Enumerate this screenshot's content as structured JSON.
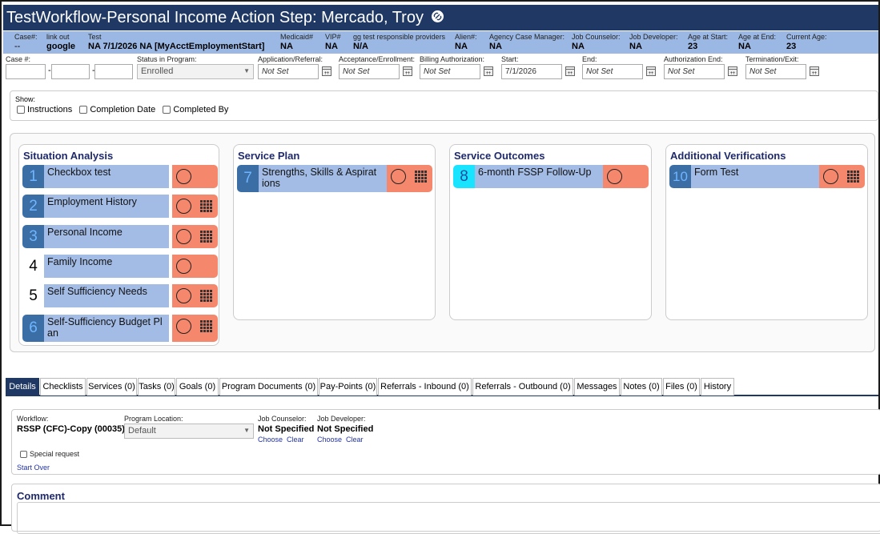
{
  "title": "TestWorkflow-Personal Income Action Step: Mercado, Troy",
  "info": [
    {
      "label": "Case#:",
      "value": "--"
    },
    {
      "label": "link out",
      "value": "google"
    },
    {
      "label": "Test",
      "value": "NA 7/1/2026 NA [MyAcctEmploymentStart]"
    },
    {
      "label": "Medicaid#",
      "value": "NA"
    },
    {
      "label": "VIP#",
      "value": "NA"
    },
    {
      "label": "gg test responsible providers",
      "value": "N/A"
    },
    {
      "label": "Alien#:",
      "value": "NA"
    },
    {
      "label": "Agency Case Manager:",
      "value": "NA"
    },
    {
      "label": "Job Counselor:",
      "value": "NA"
    },
    {
      "label": "Job Developer:",
      "value": "NA"
    },
    {
      "label": "Age at Start:",
      "value": "23"
    },
    {
      "label": "Age at End:",
      "value": "NA"
    },
    {
      "label": "Current Age:",
      "value": "23"
    }
  ],
  "fields": {
    "case_label": "Case #:",
    "status_label": "Status in Program:",
    "status_value": "Enrolled",
    "dates": [
      {
        "label": "Application/Referral:",
        "value": "Not Set"
      },
      {
        "label": "Acceptance/Enrollment:",
        "value": "Not Set"
      },
      {
        "label": "Billing Authorization:",
        "value": "Not Set"
      },
      {
        "label": "Start:",
        "value": "7/1/2026"
      },
      {
        "label": "End:",
        "value": "Not Set"
      },
      {
        "label": "Authorization End:",
        "value": "Not Set"
      },
      {
        "label": "Termination/Exit:",
        "value": "Not Set"
      }
    ]
  },
  "show": {
    "label": "Show:",
    "options": [
      "Instructions",
      "Completion Date",
      "Completed By"
    ]
  },
  "columns": [
    {
      "title": "Situation Analysis",
      "steps": [
        {
          "num": "1",
          "name": "Checkbox test"
        },
        {
          "num": "2",
          "name": "Employment History"
        },
        {
          "num": "3",
          "name": "Personal Income"
        },
        {
          "num": "4",
          "name": "Family Income"
        },
        {
          "num": "5",
          "name": "Self Sufficiency Needs"
        },
        {
          "num": "6",
          "name": "Self-Sufficiency Budget Pl an"
        }
      ]
    },
    {
      "title": "Service Plan",
      "steps": [
        {
          "num": "7",
          "name": "Strengths, Skills & Aspirat ions"
        }
      ]
    },
    {
      "title": "Service Outcomes",
      "steps": [
        {
          "num": "8",
          "name": "6-month FSSP Follow-Up"
        }
      ]
    },
    {
      "title": "Additional Verifications",
      "steps": [
        {
          "num": "10",
          "name": "Form Test"
        }
      ]
    }
  ],
  "tabs": [
    "Details",
    "Checklists",
    "Services (0)",
    "Tasks (0)",
    "Goals (0)",
    "Program Documents (0)",
    "Pay-Points (0)",
    "Referrals - Inbound (0)",
    "Referrals - Outbound (0)",
    "Messages",
    "Notes (0)",
    "Files (0)",
    "History"
  ],
  "details": {
    "workflow_label": "Workflow:",
    "workflow_value": "RSSP (CFC)-Copy (00035)",
    "location_label": "Program Location:",
    "location_value": "Default",
    "job_counselor_label": "Job Counselor:",
    "job_counselor_value": "Not Specified",
    "job_developer_label": "Job Developer:",
    "job_developer_value": "Not Specified",
    "choose": "Choose",
    "clear": "Clear",
    "special_request": "Special request",
    "start_over": "Start Over"
  },
  "comment": {
    "title": "Comment"
  },
  "colors": {
    "header": "#1f3864",
    "infobar": "#9bb8e4",
    "step_name": "#a3bce6",
    "status": "#f4876c",
    "step_num": "#3a6ea5",
    "current_step": "#19e4ff"
  }
}
